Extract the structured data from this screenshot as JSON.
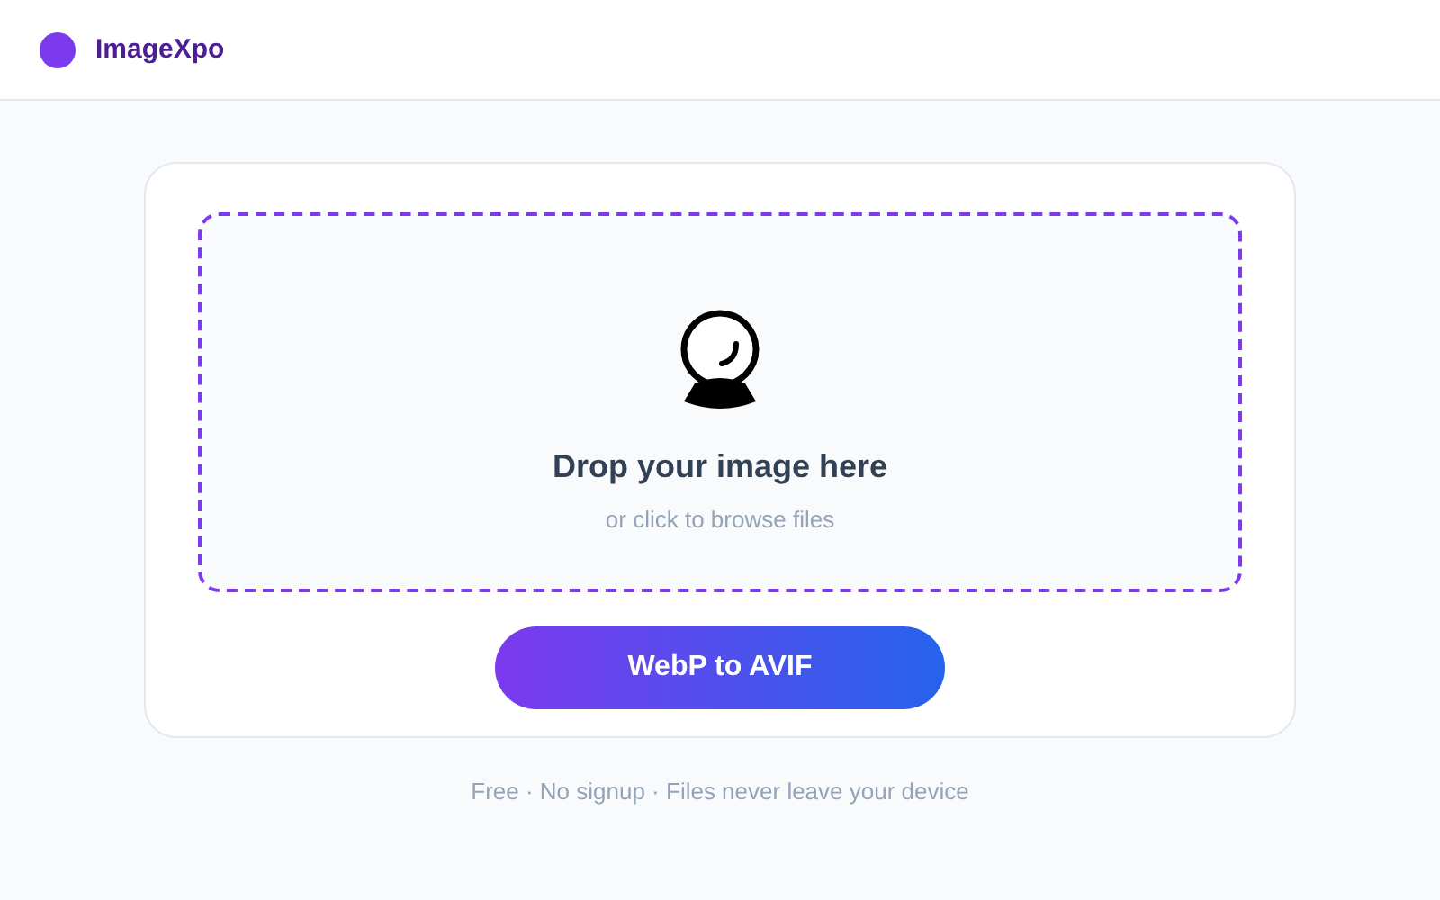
{
  "header": {
    "brand": "ImageXpo"
  },
  "dropzone": {
    "title": "Drop your image here",
    "hint": "or click to browse files"
  },
  "convert_button": {
    "label": "WebP to AVIF"
  },
  "footer": {
    "note": "Free · No signup · Files never leave your device"
  }
}
